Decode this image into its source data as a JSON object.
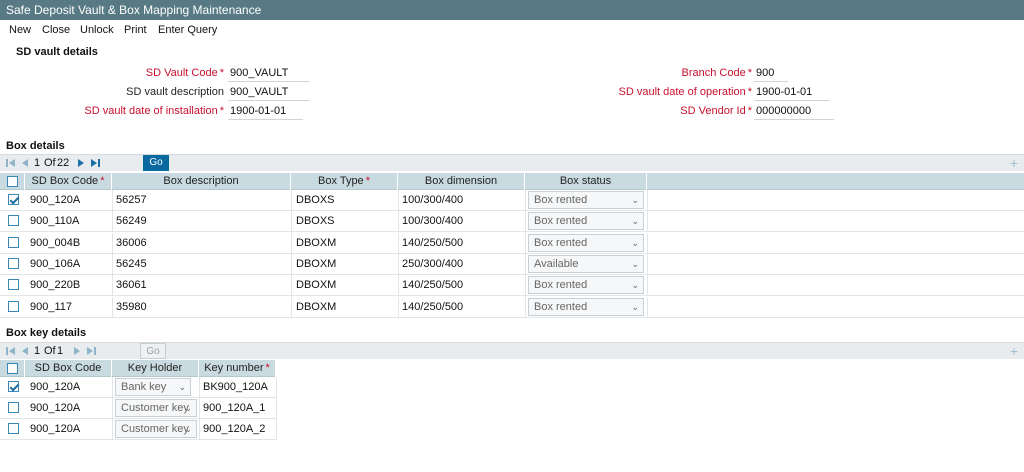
{
  "window": {
    "title": "Safe Deposit Vault & Box Mapping Maintenance"
  },
  "menu": [
    "New",
    "Close",
    "Unlock",
    "Print",
    "Enter Query"
  ],
  "vault_section": {
    "title": "SD vault details",
    "vault_code": {
      "label": "SD Vault Code",
      "value": "900_VAULT"
    },
    "vault_description": {
      "label": "SD vault description",
      "value": "900_VAULT"
    },
    "install_date": {
      "label": "SD vault date of installation",
      "value": "1900-01-01"
    },
    "branch_code": {
      "label": "Branch Code",
      "value": "900"
    },
    "operation_date": {
      "label": "SD vault date of operation",
      "value": "1900-01-01"
    },
    "vendor_id": {
      "label": "SD Vendor Id",
      "value": "000000000"
    }
  },
  "box_section": {
    "title": "Box details",
    "pager": {
      "current": "1",
      "of_label": "Of",
      "total": "22",
      "go": "Go"
    },
    "columns": [
      "SD Box Code",
      "Box description",
      "Box Type",
      "Box dimension",
      "Box status"
    ],
    "rows": [
      {
        "checked": true,
        "code": "900_120A",
        "desc": "56257",
        "type": "DBOXS",
        "dim": "100/300/400",
        "status": "Box rented"
      },
      {
        "checked": false,
        "code": "900_110A",
        "desc": "56249",
        "type": "DBOXS",
        "dim": "100/300/400",
        "status": "Box rented"
      },
      {
        "checked": false,
        "code": "900_004B",
        "desc": "36006",
        "type": "DBOXM",
        "dim": "140/250/500",
        "status": "Box rented"
      },
      {
        "checked": false,
        "code": "900_106A",
        "desc": "56245",
        "type": "DBOXM",
        "dim": "250/300/400",
        "status": "Available"
      },
      {
        "checked": false,
        "code": "900_220B",
        "desc": "36061",
        "type": "DBOXM",
        "dim": "140/250/500",
        "status": "Box rented"
      },
      {
        "checked": false,
        "code": "900_117",
        "desc": "35980",
        "type": "DBOXM",
        "dim": "140/250/500",
        "status": "Box rented"
      }
    ]
  },
  "key_section": {
    "title": "Box key details",
    "pager": {
      "current": "1",
      "of_label": "Of",
      "total": "1",
      "go": "Go"
    },
    "columns": [
      "SD Box Code",
      "Key Holder",
      "Key number"
    ],
    "rows": [
      {
        "checked": true,
        "code": "900_120A",
        "holder": "Bank key",
        "key": "BK900_120A"
      },
      {
        "checked": false,
        "code": "900_120A",
        "holder": "Customer key",
        "key": "900_120A_1"
      },
      {
        "checked": false,
        "code": "900_120A",
        "holder": "Customer key",
        "key": "900_120A_2"
      }
    ]
  },
  "colors": {
    "titlebar": "#577a84",
    "header": "#c9dbe1",
    "required": "#c8102e",
    "accent": "#0a6aa0"
  },
  "icons": [
    "first-page-icon",
    "prev-page-icon",
    "next-page-icon",
    "last-page-icon",
    "add-row-icon",
    "checkbox-icon",
    "chevron-down-icon"
  ]
}
